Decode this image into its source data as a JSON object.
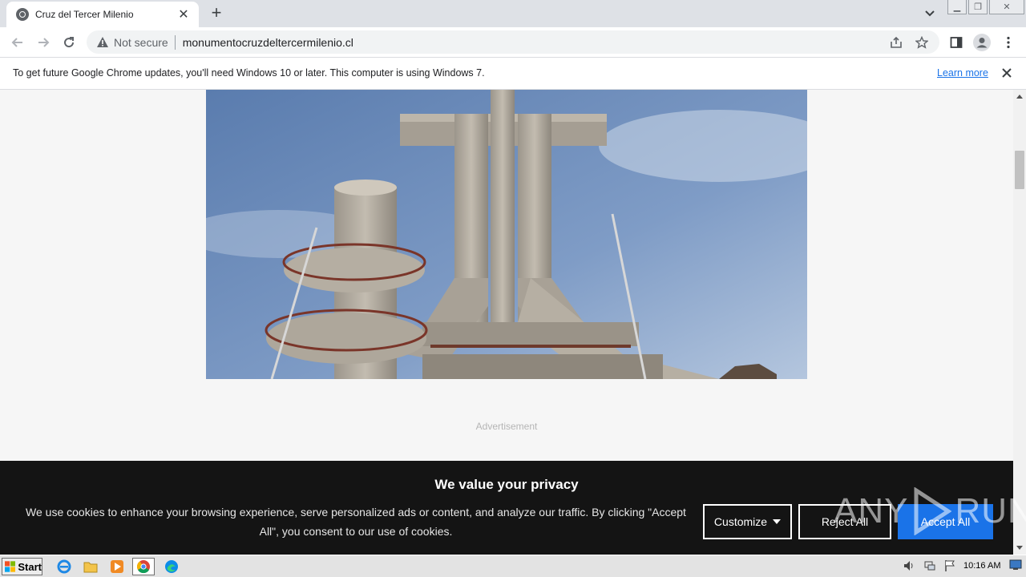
{
  "browser": {
    "tab_title": "Cruz del Tercer Milenio",
    "security_label": "Not secure",
    "url": "monumentocruzdeltercermilenio.cl"
  },
  "infobar": {
    "message": "To get future Google Chrome updates, you'll need Windows 10 or later. This computer is using Windows 7.",
    "link_label": "Learn more"
  },
  "page": {
    "photo_subject": "Cruz del Tercer Milenio monument",
    "ad_label": "Advertisement"
  },
  "cookie_banner": {
    "title": "We value your privacy",
    "text": "We use cookies to enhance your browsing experience, serve personalized ads or content, and analyze our traffic. By clicking \"Accept All\", you consent to our use of cookies.",
    "customize_label": "Customize",
    "reject_label": "Reject All",
    "accept_label": "Accept All",
    "accept_color": "#1a73e8"
  },
  "watermark": {
    "text_left": "ANY",
    "text_right": "RUN"
  },
  "taskbar": {
    "start_label": "Start",
    "apps": [
      "ie-icon",
      "folder-icon",
      "media-player-icon",
      "chrome-icon",
      "edge-icon"
    ],
    "clock": "10:16 AM"
  }
}
